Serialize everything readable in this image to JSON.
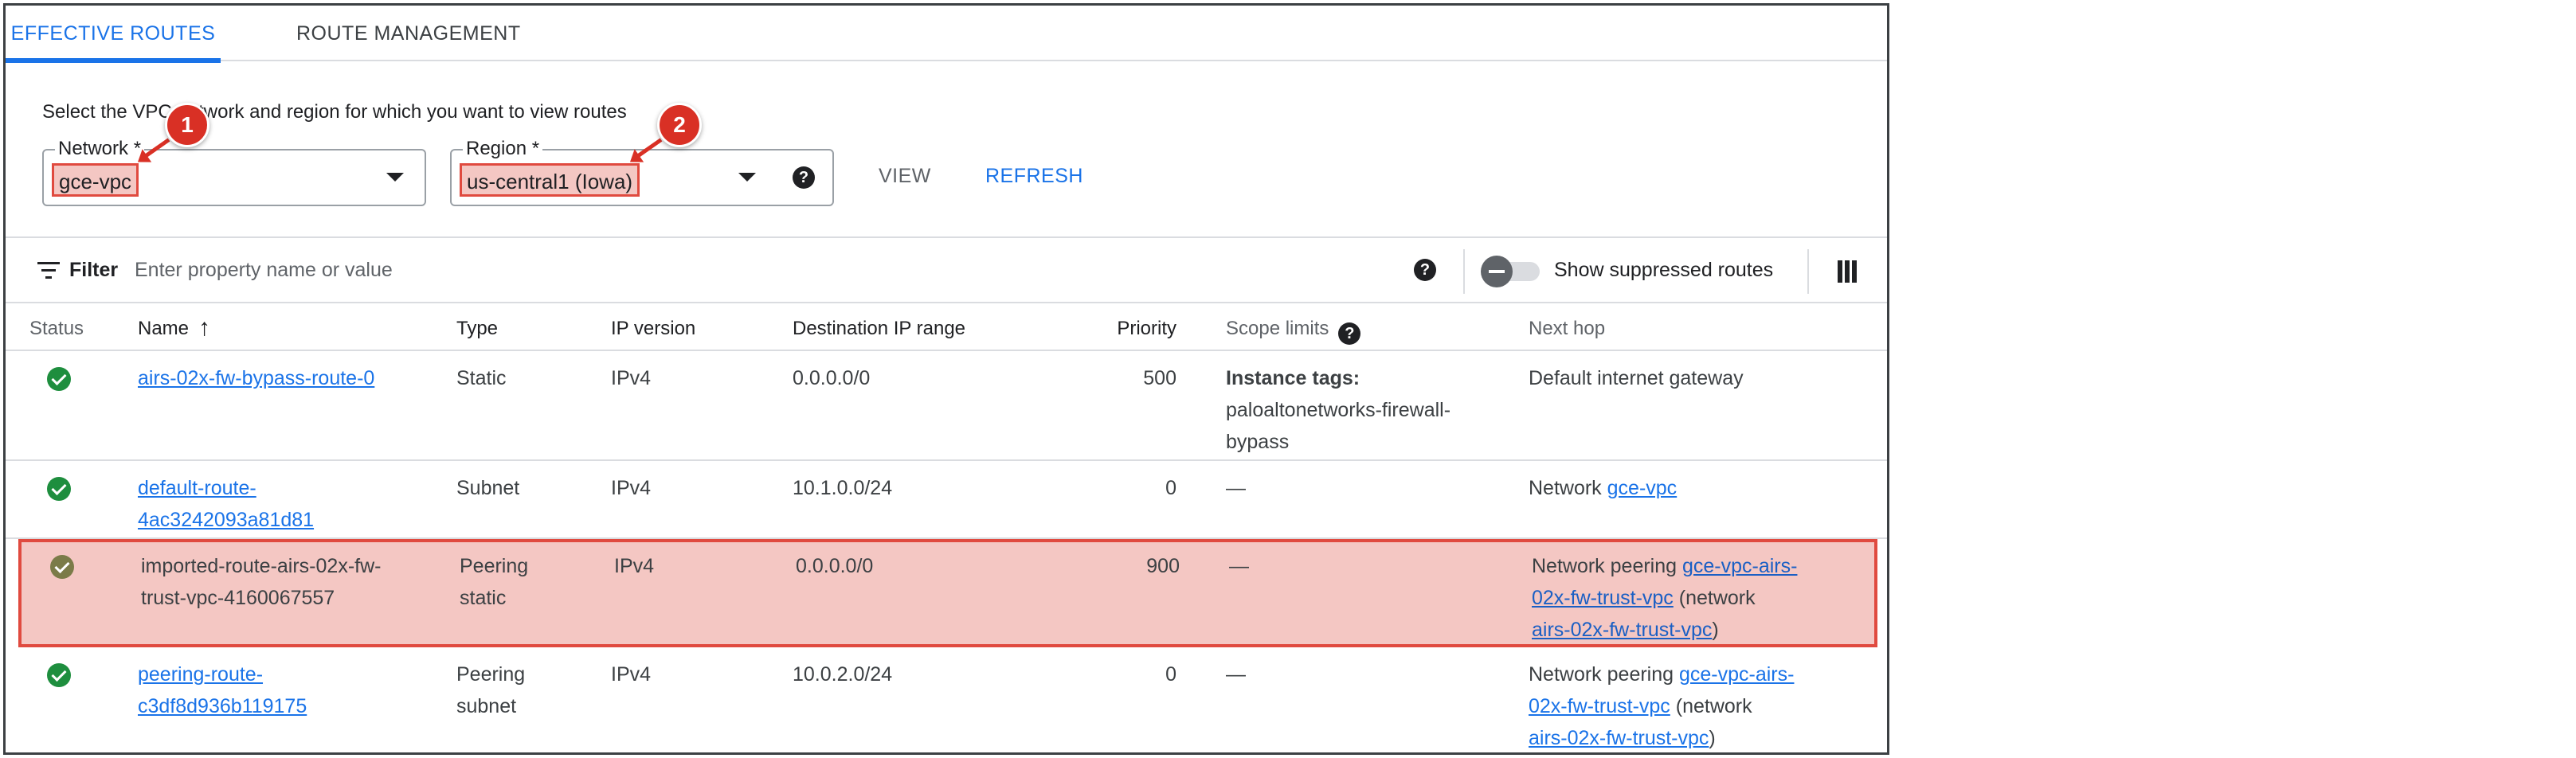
{
  "tabs": {
    "effective_routes": "EFFECTIVE ROUTES",
    "route_management": "ROUTE MANAGEMENT"
  },
  "selector": {
    "caption": "Select the VPC network and region for which you want to view routes",
    "network_label": "Network *",
    "network_value": "gce-vpc",
    "region_label": "Region *",
    "region_value": "us-central1 (Iowa)",
    "view_button": "VIEW",
    "refresh_button": "REFRESH",
    "badge_1": "1",
    "badge_2": "2"
  },
  "filter": {
    "label": "Filter",
    "placeholder": "Enter property name or value",
    "toggle_label": "Show suppressed routes",
    "toggle_on": false
  },
  "table": {
    "headers": {
      "status": "Status",
      "name": "Name",
      "type": "Type",
      "ip_version": "IP version",
      "destination": "Destination IP range",
      "priority": "Priority",
      "scope": "Scope limits",
      "next_hop": "Next hop"
    },
    "rows": [
      {
        "name_line1": "airs-02x-fw-bypass-route-0",
        "name_line2": "",
        "type_line1": "Static",
        "type_line2": "",
        "ip_version": "IPv4",
        "destination": "0.0.0.0/0",
        "priority": "500",
        "scope_title": "Instance tags:",
        "scope_line1": "paloaltonetworks-firewall-",
        "scope_line2": "bypass",
        "hop_text": "Default internet gateway"
      },
      {
        "name_line1": "default-route-",
        "name_line2": "4ac3242093a81d81",
        "type_line1": "Subnet",
        "ip_version": "IPv4",
        "destination": "10.1.0.0/24",
        "priority": "0",
        "scope": "—",
        "hop_prefix": "Network ",
        "hop_link": "gce-vpc"
      },
      {
        "name_line1": "imported-route-airs-02x-fw-",
        "name_line2": "trust-vpc-4160067557",
        "type_line1": "Peering",
        "type_line2": "static",
        "ip_version": "IPv4",
        "destination": "0.0.0.0/0",
        "priority": "900",
        "scope": "—",
        "hop_prefix": "Network peering ",
        "hop_link1a": "gce-vpc-airs-",
        "hop_link1b": "02x-fw-trust-vpc",
        "hop_mid": " (network",
        "hop_link2": "airs-02x-fw-trust-vpc",
        "hop_suffix": ")"
      },
      {
        "name_line1": "peering-route-",
        "name_line2": "c3df8d936b119175",
        "type_line1": "Peering",
        "type_line2": "subnet",
        "ip_version": "IPv4",
        "destination": "10.0.2.0/24",
        "priority": "0",
        "scope": "—",
        "hop_prefix": "Network peering ",
        "hop_link1a": "gce-vpc-airs-",
        "hop_link1b": "02x-fw-trust-vpc",
        "hop_mid": " (network",
        "hop_link2": "airs-02x-fw-trust-vpc",
        "hop_suffix": ")"
      }
    ]
  },
  "colors": {
    "accent": "#1a73e8",
    "highlight_fill": "#f4c7c3",
    "highlight_border": "#e04a3f",
    "status_ok": "#1e8e3e"
  },
  "icons": [
    "filter-icon",
    "help-icon",
    "sort-ascending-icon",
    "columns-icon",
    "status-ok-icon",
    "dropdown-arrow-icon"
  ]
}
